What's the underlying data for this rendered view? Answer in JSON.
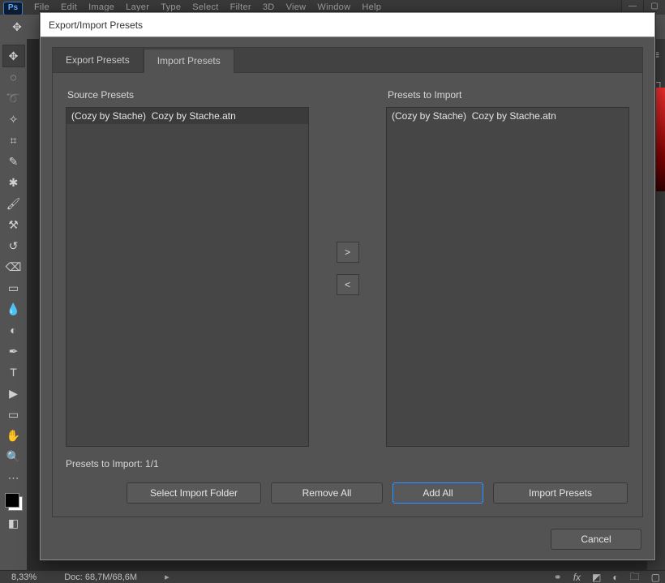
{
  "app": {
    "badge": "Ps",
    "menu_items": [
      "File",
      "Edit",
      "Image",
      "Layer",
      "Type",
      "Select",
      "Filter",
      "3D",
      "View",
      "Window",
      "Help"
    ],
    "status_zoom": "8,33%",
    "status_doc": "Doc: 68,7M/68,6M"
  },
  "dialog": {
    "title": "Export/Import Presets",
    "tabs": {
      "export": "Export Presets",
      "import": "Import Presets"
    },
    "source_label": "Source Presets",
    "dest_label": "Presets to Import",
    "source_items": {
      "0": "(Cozy by Stache)  Cozy by Stache.atn"
    },
    "dest_items": {
      "0": "(Cozy by Stache)  Cozy by Stache.atn"
    },
    "move_right": ">",
    "move_left": "<",
    "count_label": "Presets to Import: 1/1",
    "buttons": {
      "select_folder": "Select Import Folder",
      "remove_all": "Remove All",
      "add_all": "Add All",
      "import_presets": "Import Presets",
      "cancel": "Cancel"
    }
  }
}
